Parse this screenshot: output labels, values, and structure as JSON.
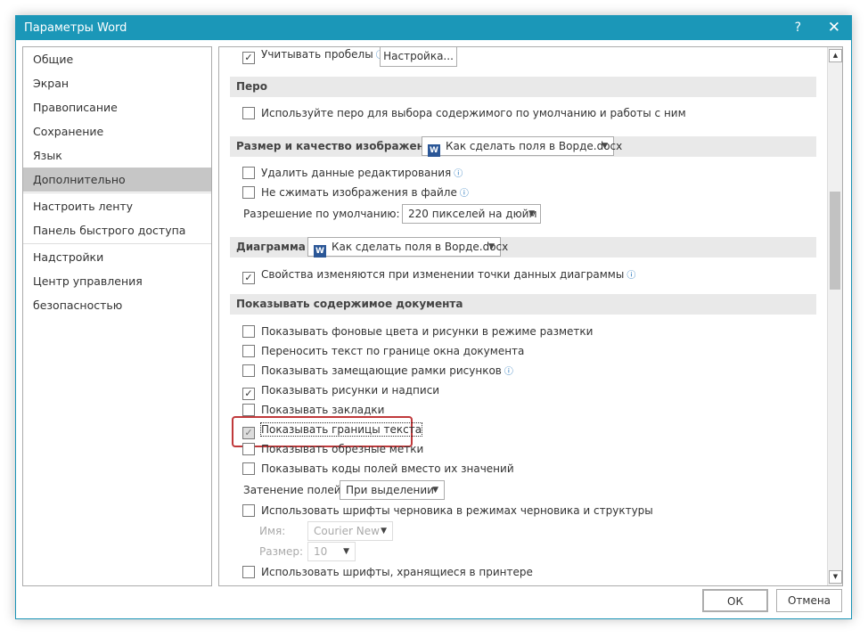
{
  "window": {
    "title": "Параметры Word",
    "help": "?",
    "close": "✕"
  },
  "sidebar": {
    "items": [
      {
        "label": "Общие"
      },
      {
        "label": "Экран"
      },
      {
        "label": "Правописание"
      },
      {
        "label": "Сохранение"
      },
      {
        "label": "Язык"
      },
      {
        "label": "Дополнительно",
        "selected": true
      },
      {
        "label": "Настроить ленту"
      },
      {
        "label": "Панель быстрого доступа"
      },
      {
        "label": "Надстройки"
      },
      {
        "label": "Центр управления безопасностью"
      }
    ]
  },
  "main": {
    "top_row": {
      "label": "Учитывать пробелы",
      "checked": true,
      "button": "Настройка..."
    },
    "pen": {
      "header": "Перо",
      "option": {
        "label": "Используйте перо для выбора содержимого по умолчанию и работы с ним",
        "checked": false
      }
    },
    "image": {
      "header": "Размер и качество изображения",
      "doc": "Как сделать поля в Ворде.docx",
      "options": [
        {
          "label": "Удалить данные редактирования",
          "checked": false
        },
        {
          "label": "Не сжимать изображения в файле",
          "checked": false
        }
      ],
      "resolution_label": "Разрешение по умолчанию:",
      "resolution": "220 пикселей на дюйм"
    },
    "chart": {
      "header": "Диаграмма",
      "doc": "Как сделать поля в Ворде.docx",
      "option": {
        "label": "Свойства изменяются при изменении точки данных диаграммы",
        "checked": true
      }
    },
    "show": {
      "header": "Показывать содержимое документа",
      "options": [
        {
          "label": "Показывать фоновые цвета и рисунки в режиме разметки",
          "checked": false
        },
        {
          "label": "Переносить текст по границе окна документа",
          "checked": false
        },
        {
          "label": "Показывать замещающие рамки рисунков",
          "checked": false
        },
        {
          "label": "Показывать рисунки и надписи",
          "checked": true
        },
        {
          "label": "Показывать закладки",
          "checked": false
        },
        {
          "label": "Показывать границы текста",
          "checked": true
        },
        {
          "label": "Показывать обрезные метки",
          "checked": false
        },
        {
          "label": "Показывать коды полей вместо их значений",
          "checked": false
        }
      ],
      "shading_label": "Затенение полей:",
      "shading": "При выделении",
      "draft_fonts": {
        "label": "Использовать шрифты черновика в режимах черновика и структуры",
        "checked": false
      },
      "name_label": "Имя:",
      "name": "Courier New",
      "size_label": "Размер:",
      "size": "10",
      "printer_fonts": {
        "label": "Использовать шрифты, хранящиеся в принтере",
        "checked": false
      }
    }
  },
  "footer": {
    "ok": "ОК",
    "cancel": "Отмена"
  },
  "colors": {
    "titlebar": "#1b97b8",
    "highlight": "#c0393b"
  }
}
